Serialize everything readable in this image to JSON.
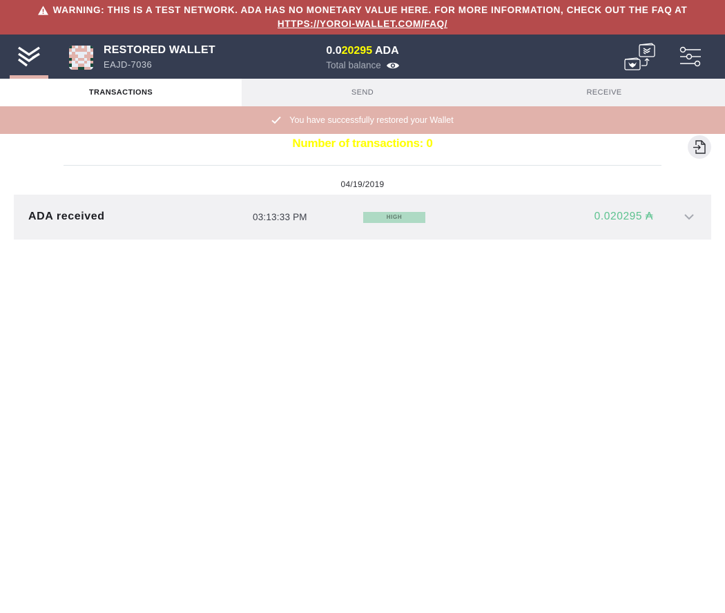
{
  "warning": {
    "text": "WARNING: THIS IS A TEST NETWORK. ADA HAS NO MONETARY VALUE HERE. FOR MORE INFORMATION, CHECK OUT THE FAQ AT",
    "link_text": "HTTPS://YOROI-WALLET.COM/FAQ/",
    "icon": "warning-triangle-icon"
  },
  "topbar": {
    "logo_icon": "yoroi-logo-icon",
    "wallet_name": "RESTORED WALLET",
    "wallet_plate": "EAJD-7036",
    "balance_prefix": "0.0",
    "balance_highlight": "20295",
    "balance_unit": "ADA",
    "balance_label": "Total balance",
    "eye_icon": "eye-icon",
    "wallet_switch_icon": "wallet-switch-icon",
    "settings_icon": "settings-sliders-icon"
  },
  "tabs": [
    {
      "label": "TRANSACTIONS",
      "active": true
    },
    {
      "label": "SEND",
      "active": false
    },
    {
      "label": "RECEIVE",
      "active": false
    }
  ],
  "notice": {
    "text": "You have successfully restored your Wallet",
    "icon": "check-icon"
  },
  "summary": {
    "count_text": "Number of transactions: 0",
    "export_icon": "export-file-icon"
  },
  "groups": [
    {
      "date": "04/19/2019",
      "transactions": [
        {
          "type": "ADA received",
          "time": "03:13:33 PM",
          "assurance": "HIGH",
          "amount": "0.020295",
          "currency_symbol": "₳"
        }
      ]
    }
  ],
  "colors": {
    "warning_bg": "#b54b4c",
    "topbar_bg": "#353d51",
    "notice_bg": "#e1b2ab",
    "amount_green": "#5cc28f",
    "badge_bg": "#aedac4",
    "highlight_yellow": "#ffff00"
  }
}
